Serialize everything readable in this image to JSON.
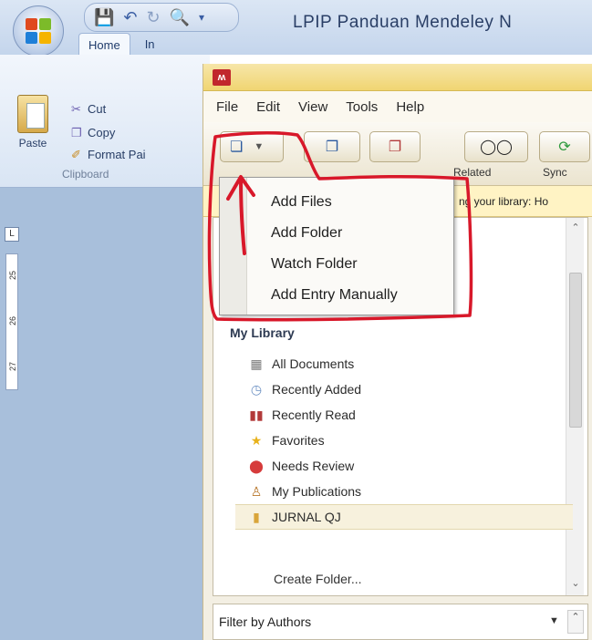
{
  "word": {
    "title": "LPIP Panduan Mendeley N",
    "qat_icons": [
      "save-icon",
      "undo-icon",
      "redo-icon",
      "print-preview-icon",
      "qat-dropdown-icon"
    ],
    "tabs": [
      "Home",
      "In"
    ],
    "clipboard": {
      "paste_label": "Paste",
      "cut_label": "Cut",
      "copy_label": "Copy",
      "format_painter_label": "Format Pai",
      "group_label": "Clipboard"
    },
    "ruler_corner": "L",
    "ruler_marks": [
      "25",
      "26",
      "27"
    ]
  },
  "mendeley": {
    "menu": [
      "File",
      "Edit",
      "View",
      "Tools",
      "Help"
    ],
    "toolbar": {
      "related_label": "Related",
      "sync_label": "Sync"
    },
    "notice": "ng your library: Ho",
    "add_menu": [
      "Add Files",
      "Add Folder",
      "Watch Folder",
      "Add Entry Manually"
    ],
    "sidebar": {
      "title": "My Library",
      "items": [
        {
          "label": "All Documents",
          "icon": "all-documents-icon"
        },
        {
          "label": "Recently Added",
          "icon": "recently-added-icon"
        },
        {
          "label": "Recently Read",
          "icon": "recently-read-icon"
        },
        {
          "label": "Favorites",
          "icon": "favorites-star-icon"
        },
        {
          "label": "Needs Review",
          "icon": "needs-review-icon"
        },
        {
          "label": "My Publications",
          "icon": "my-publications-icon"
        },
        {
          "label": "JURNAL QJ",
          "icon": "folder-icon"
        }
      ],
      "create_folder": "Create Folder..."
    },
    "filter_label": "Filter by Authors"
  },
  "colors": {
    "annotation_red": "#d8182a",
    "mendeley_title_yellow": "#f0d572",
    "word_blue": "#c4d5ec"
  }
}
